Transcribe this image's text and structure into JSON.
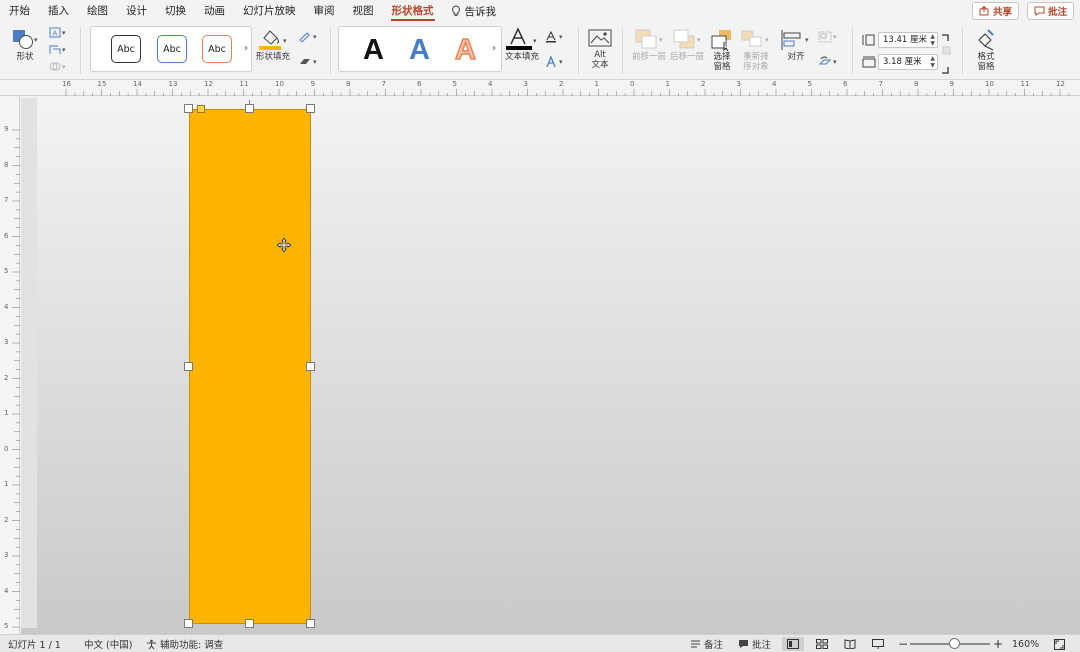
{
  "menu": {
    "tabs": [
      "开始",
      "插入",
      "绘图",
      "设计",
      "切换",
      "动画",
      "幻灯片放映",
      "审阅",
      "视图",
      "形状格式"
    ],
    "active_tab": "形状格式",
    "tell_me": "告诉我",
    "share": "共享",
    "comments": "批注"
  },
  "ribbon": {
    "shapes_label": "形状",
    "style_samples": [
      "Abc",
      "Abc",
      "Abc"
    ],
    "shape_fill_label": "形状填充",
    "wordart_glyph": "A",
    "text_fill_label": "文本填充",
    "alt_text_line1": "Alt",
    "alt_text_line2": "文本",
    "bring_forward": "前移一层",
    "send_backward": "后移一层",
    "selection_pane_line1": "选择",
    "selection_pane_line2": "窗格",
    "reorder_line1": "重新排",
    "reorder_line2": "序对象",
    "align": "对齐",
    "height_value": "13.41 厘米",
    "width_value": "3.18 厘米",
    "format_pane_line1": "格式",
    "format_pane_line2": "窗格"
  },
  "ruler": {
    "h_labels": [
      "16",
      "15",
      "14",
      "13",
      "12",
      "11",
      "10",
      "9",
      "8",
      "7",
      "6",
      "5",
      "4",
      "3",
      "2",
      "1",
      "0",
      "1",
      "2",
      "3",
      "4",
      "5",
      "6",
      "7",
      "8",
      "9",
      "10",
      "11",
      "12"
    ],
    "v_labels": [
      "9",
      "8",
      "7",
      "6",
      "5",
      "4",
      "3",
      "2",
      "1",
      "0",
      "1",
      "2",
      "3",
      "4",
      "5"
    ]
  },
  "slide": {
    "shape_color": "#FFB400"
  },
  "status": {
    "slide_counter": "幻灯片 1 / 1",
    "language": "中文 (中国)",
    "accessibility": "辅助功能: 调查",
    "notes": "备注",
    "comments": "批注",
    "zoom": "160%",
    "zoom_fraction": 0.55
  },
  "colors": {
    "accent": "#B7472A",
    "shape_fill": "#FFB400"
  }
}
